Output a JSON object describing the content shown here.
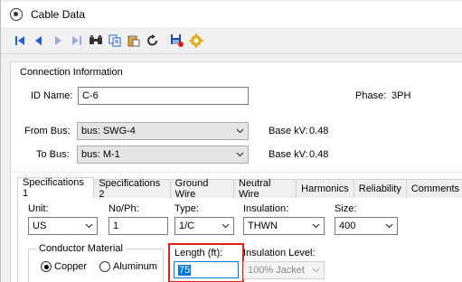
{
  "window": {
    "title": "Cable Data"
  },
  "toolbar": {
    "buttons": [
      "first-record-icon",
      "previous-record-icon",
      "next-record-icon",
      "last-record-icon",
      "find-icon",
      "copy-icon",
      "paste-icon",
      "undo-icon",
      "save-icon",
      "settings-icon"
    ]
  },
  "connection": {
    "group_label": "Connection Information",
    "id_label": "ID Name:",
    "id_value": "C-6",
    "phase_label": "Phase:",
    "phase_value": "3PH",
    "from_label": "From Bus:",
    "from_value": "bus: SWG-4",
    "from_kv_label": "Base kV:",
    "from_kv_value": "0.48",
    "to_label": "To Bus:",
    "to_value": "bus: M-1",
    "to_kv_label": "Base kV:",
    "to_kv_value": "0.48"
  },
  "tabs": [
    "Specifications 1",
    "Specifications 2",
    "Ground Wire",
    "Neutral Wire",
    "Harmonics",
    "Reliability",
    "Comments"
  ],
  "spec1": {
    "unit_label": "Unit:",
    "unit_value": "US",
    "noph_label": "No/Ph:",
    "noph_value": "1",
    "type_label": "Type:",
    "type_value": "1/C",
    "insulation_label": "Insulation:",
    "insulation_value": "THWN",
    "size_label": "Size:",
    "size_value": "400",
    "conductor_group": "Conductor Material",
    "copper_label": "Copper",
    "aluminum_label": "Aluminum",
    "length_label": "Length (ft):",
    "length_value": "75",
    "ins_level_label": "Insulation Level:",
    "ins_level_value": "100% Jacket"
  },
  "colors": {
    "accent": "#0078d7",
    "highlight": "#e0201c",
    "icon_blue": "#1f5fc7"
  }
}
